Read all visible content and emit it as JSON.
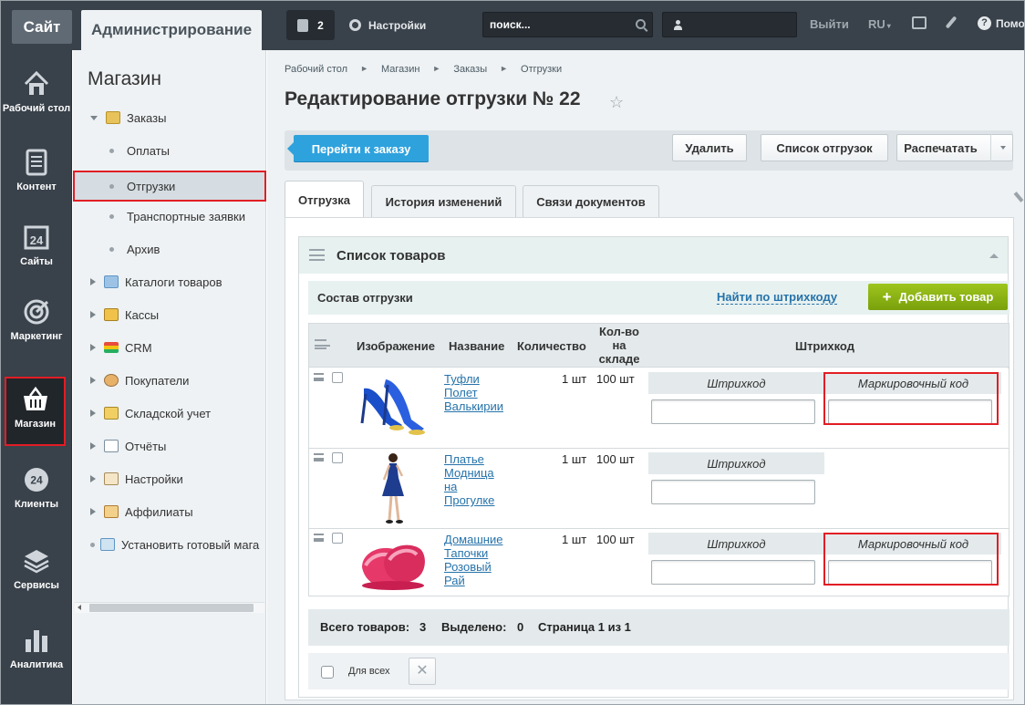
{
  "topbar": {
    "site": "Сайт",
    "admin": "Администрирование",
    "notif_count": "2",
    "settings": "Настройки",
    "search_placeholder": "поиск...",
    "logout": "Выйти",
    "lang": "RU",
    "help": "Помо"
  },
  "leftbar": {
    "items": [
      {
        "label": "Рабочий стол",
        "icon": "home-icon"
      },
      {
        "label": "Контент",
        "icon": "document-icon"
      },
      {
        "label": "Сайты",
        "icon": "calendar-24-icon"
      },
      {
        "label": "Маркетинг",
        "icon": "target-icon"
      },
      {
        "label": "Магазин",
        "icon": "basket-icon"
      },
      {
        "label": "Клиенты",
        "icon": "clients-24-icon"
      },
      {
        "label": "Сервисы",
        "icon": "layers-icon"
      },
      {
        "label": "Аналитика",
        "icon": "bar-chart-icon"
      }
    ]
  },
  "menu": {
    "title": "Магазин",
    "items": [
      {
        "label": "Заказы",
        "icon": "orders-folder-icon"
      },
      {
        "label": "Оплаты"
      },
      {
        "label": "Отгрузки"
      },
      {
        "label": "Транспортные заявки"
      },
      {
        "label": "Архив"
      },
      {
        "label": "Каталоги товаров",
        "icon": "folder-icon"
      },
      {
        "label": "Кассы",
        "icon": "cash-register-icon"
      },
      {
        "label": "CRM",
        "icon": "crm-icon"
      },
      {
        "label": "Покупатели",
        "icon": "customers-icon"
      },
      {
        "label": "Складской учет",
        "icon": "warehouse-icon"
      },
      {
        "label": "Отчёты",
        "icon": "reports-icon"
      },
      {
        "label": "Настройки",
        "icon": "settings-icon"
      },
      {
        "label": "Аффилиаты",
        "icon": "affiliates-icon"
      },
      {
        "label": "Установить готовый мага",
        "icon": "cart-icon"
      }
    ]
  },
  "breadcrumbs": [
    "Рабочий стол",
    "Магазин",
    "Заказы",
    "Отгрузки"
  ],
  "page_title": "Редактирование отгрузки № 22",
  "toolbar": {
    "go_to_order": "Перейти к заказу",
    "delete": "Удалить",
    "shipments_list": "Список отгрузок",
    "print": "Распечатать"
  },
  "tabs": [
    "Отгрузка",
    "История изменений",
    "Связи документов"
  ],
  "section": {
    "title": "Список товаров",
    "composition": "Состав отгрузки",
    "find_by_barcode": "Найти по штрихкоду",
    "add_product": "Добавить товар"
  },
  "table": {
    "headers": {
      "image": "Изображение",
      "name": "Название",
      "quantity": "Количество",
      "stock": "Кол-во на складе",
      "barcode": "Штрихкод"
    },
    "barcode_label": "Штрихкод",
    "marking_label": "Маркировочный код",
    "rows": [
      {
        "name": "Туфли Полет Валькирии",
        "qty": "1 шт",
        "stock": "100 шт",
        "has_marking": true,
        "image": "blue-heels-image"
      },
      {
        "name": "Платье Модница на Прогулке",
        "qty": "1 шт",
        "stock": "100 шт",
        "has_marking": false,
        "image": "dress-model-image"
      },
      {
        "name": "Домашние Тапочки Розовый Рай",
        "qty": "1 шт",
        "stock": "100 шт",
        "has_marking": true,
        "image": "pink-slippers-image"
      }
    ]
  },
  "footer": {
    "total_label": "Всего товаров:",
    "total_value": "3",
    "selected_label": "Выделено:",
    "selected_value": "0",
    "page_label": "Страница 1 из 1",
    "for_all": "Для всех"
  },
  "colors": {
    "accent_blue": "#2ea2dd",
    "accent_green": "#86ad00",
    "highlight_red": "#e21d24",
    "dark_bar": "#39414a"
  }
}
